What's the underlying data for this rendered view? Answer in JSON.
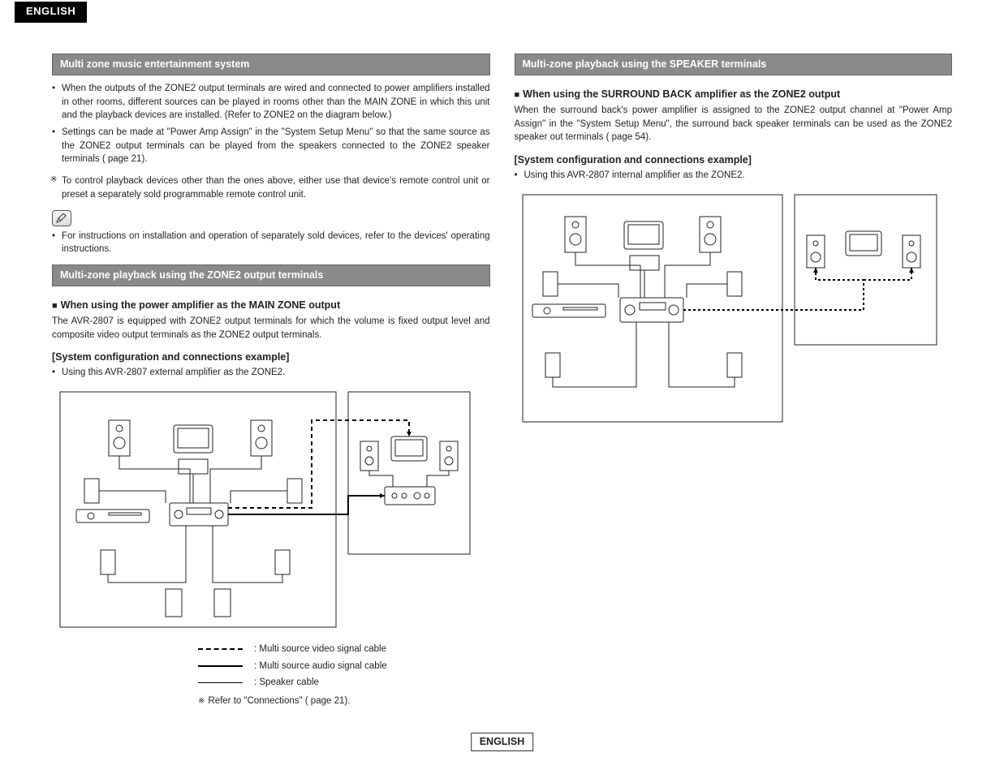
{
  "lang_top": "ENGLISH",
  "lang_bottom": "ENGLISH",
  "left": {
    "bar1": "Multi zone music entertainment system",
    "bullets1": [
      "When the outputs of the ZONE2 output terminals are wired and connected to power amplifiers installed in other rooms, different sources can be played in rooms other than the MAIN ZONE in which this unit and the playback devices are installed. (Refer to ZONE2 on the diagram below.)",
      "Settings can be made at \"Power Amp Assign\" in the \"System Setup Menu\" so that the same source as the ZONE2 output terminals can be played from the speakers connected to the ZONE2 speaker terminals ( page 21)."
    ],
    "note1": "To control playback devices other than the ones above, either use that device's remote control unit or preset a separately sold programmable remote control unit.",
    "pencil_bullet": "For instructions on installation and operation of separately sold devices, refer to the devices' operating instructions.",
    "bar2": "Multi-zone playback using the ZONE2 output terminals",
    "sub2": "When using the power amplifier as the MAIN ZONE output",
    "body2": "The AVR-2807 is equipped with ZONE2 output terminals for which the volume is fixed output level and composite video output terminals as the ZONE2 output terminals.",
    "brkt2": "[System configuration and connections example]",
    "bul2": "Using this AVR-2807 external amplifier as the ZONE2.",
    "legend": {
      "dash": "Multi source video signal cable",
      "solid": "Multi source audio signal cable",
      "thin": "Speaker cable",
      "note": "Refer to \"Connections\" ( page 21)."
    }
  },
  "right": {
    "bar1": "Multi-zone playback using the SPEAKER terminals",
    "sub1": "When using the SURROUND BACK amplifier as the ZONE2 output",
    "body1": "When the surround back's power amplifier is assigned to the ZONE2 output channel at \"Power Amp Assign\" in the \"System Setup Menu\", the surround back speaker terminals can be used as the ZONE2 speaker out terminals ( page 54).",
    "brkt1": "[System configuration and connections example]",
    "bul1": "Using this AVR-2807 internal amplifier as the ZONE2."
  }
}
